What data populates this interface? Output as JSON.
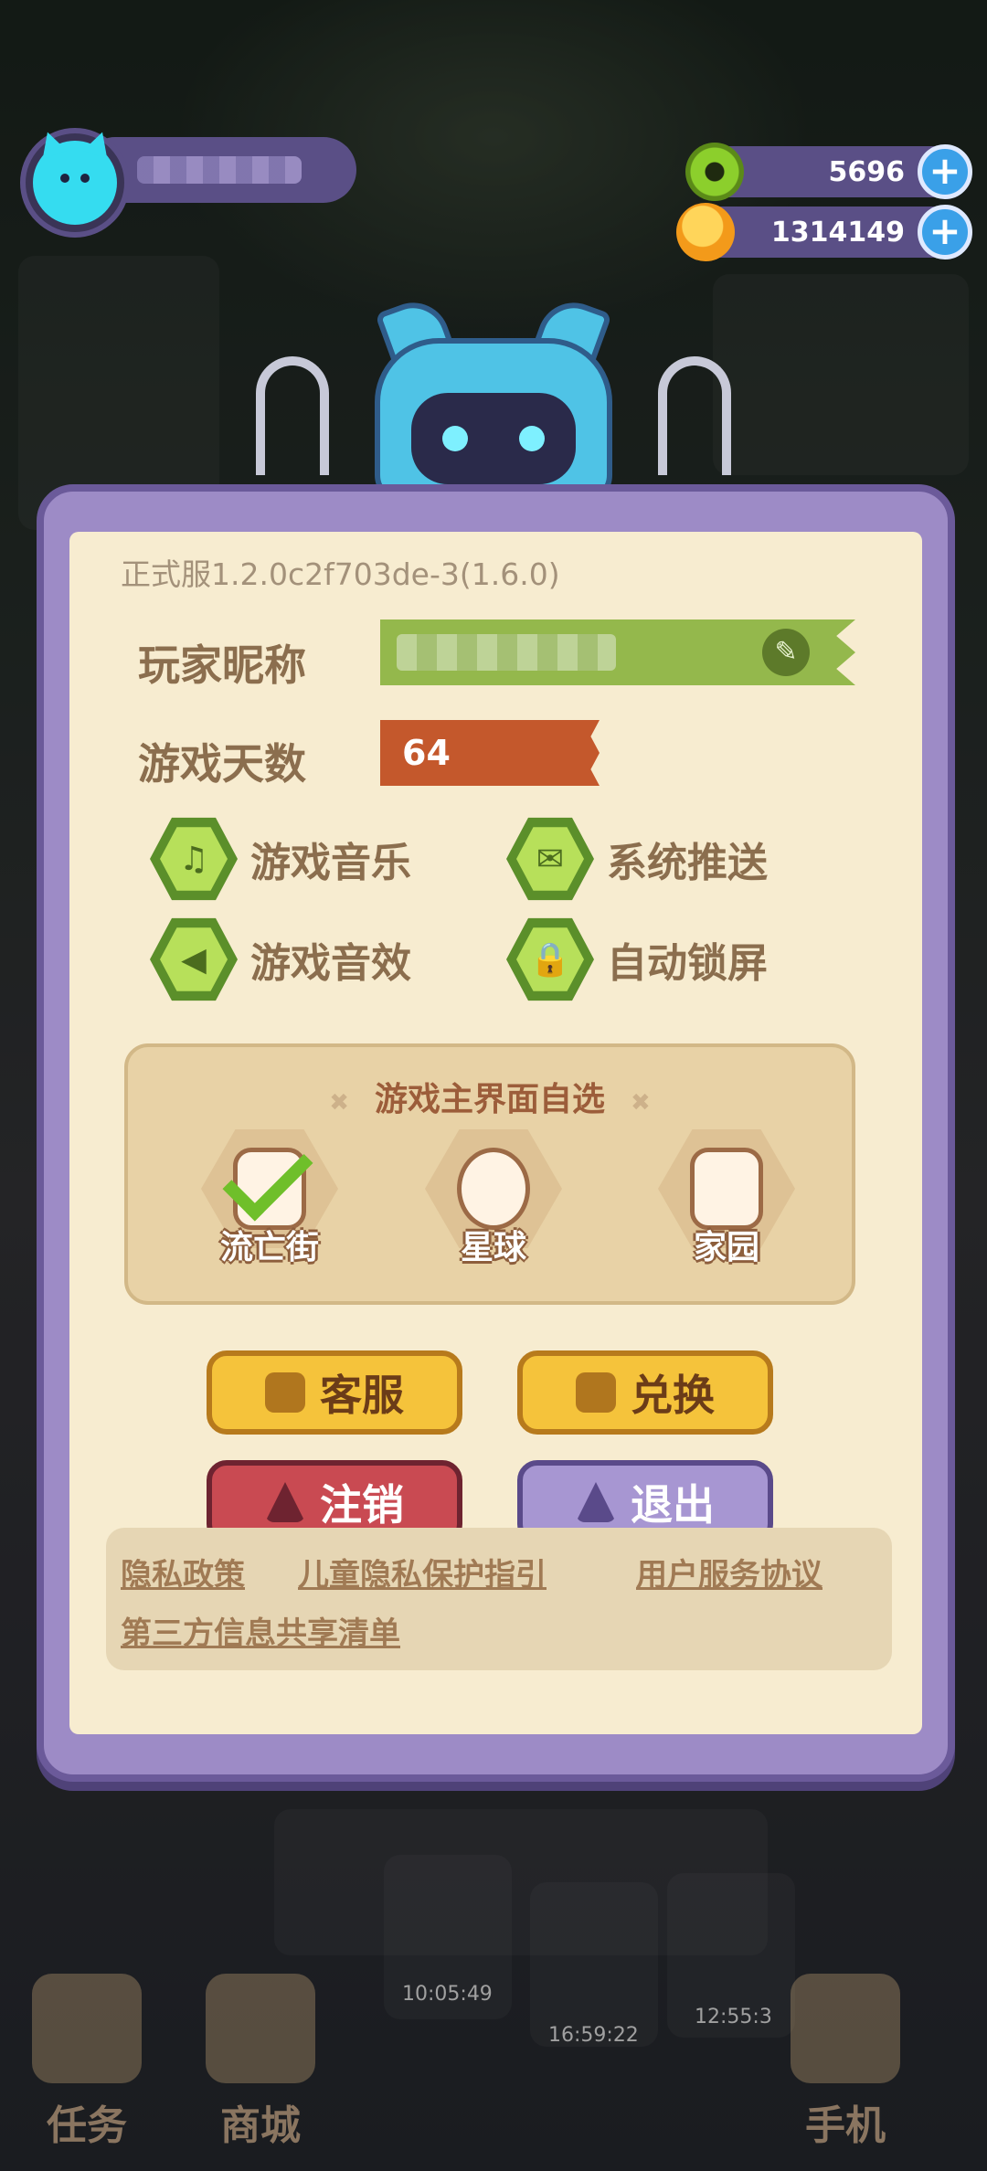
{
  "top": {
    "resources": [
      {
        "icon": "donut-currency-icon",
        "value": "5696"
      },
      {
        "icon": "coin-currency-icon",
        "value": "1314149"
      }
    ]
  },
  "panel": {
    "version": "正式服1.2.0c2f703de-3(1.6.0)",
    "nickname_label": "玩家昵称",
    "days_label": "游戏天数",
    "days_value": "64",
    "settings": [
      {
        "label": "游戏音乐",
        "icon": "music-note-icon"
      },
      {
        "label": "系统推送",
        "icon": "envelope-icon"
      },
      {
        "label": "游戏音效",
        "icon": "speaker-icon"
      },
      {
        "label": "自动锁屏",
        "icon": "lock-icon"
      }
    ],
    "theme": {
      "title": "游戏主界面自选",
      "options": [
        {
          "label": "流亡街",
          "selected": true
        },
        {
          "label": "星球",
          "selected": false
        },
        {
          "label": "家园",
          "selected": false
        }
      ]
    },
    "buttons": {
      "service": "客服",
      "redeem": "兑换",
      "cancel_account": "注销",
      "logout": "退出"
    },
    "links": {
      "privacy": "隐私政策",
      "child_privacy": "儿童隐私保护指引",
      "user_agreement": "用户服务协议",
      "third_party": "第三方信息共享清单"
    }
  },
  "bottom_nav": {
    "tasks": "任务",
    "shop": "商城",
    "phone": "手机"
  },
  "timers": [
    "10:05:49",
    "16:59:22",
    "12:55:3"
  ],
  "colors": {
    "panel_frame": "#9d8bc6",
    "panel_paper": "#f7ecd0",
    "nickname_bar": "#94b84c",
    "days_bar": "#c4582c",
    "toggle_on": "#b7e05a",
    "button_yellow": "#f5c33b",
    "button_red": "#c94a52",
    "button_purple": "#a796d2"
  }
}
